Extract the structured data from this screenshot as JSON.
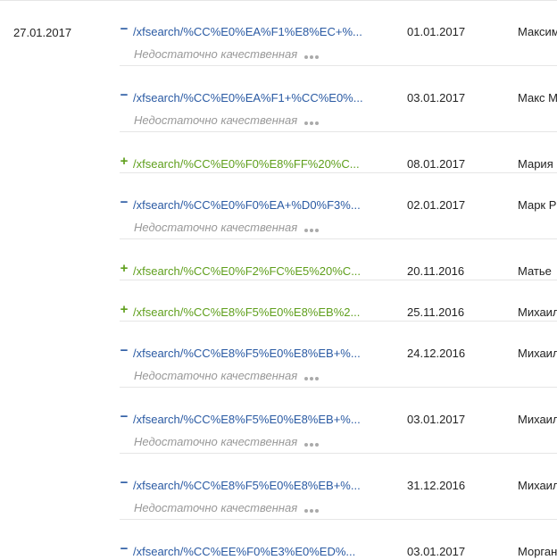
{
  "group": {
    "date": "27.01.2017"
  },
  "rows": [
    {
      "sign": "−",
      "url": "/xfsearch/%CC%E0%EA%F1%E8%EC+%...",
      "note": "Недостаточно качественная",
      "date": "01.01.2017",
      "name": "Максим"
    },
    {
      "sign": "−",
      "url": "/xfsearch/%CC%E0%EA%F1+%CC%E0%...",
      "note": "Недостаточно качественная",
      "date": "03.01.2017",
      "name": "Макс М"
    },
    {
      "sign": "+",
      "url": "/xfsearch/%CC%E0%F0%E8%FF%20%C...",
      "note": "",
      "date": "08.01.2017",
      "name": "Мария"
    },
    {
      "sign": "−",
      "url": "/xfsearch/%CC%E0%F0%EA+%D0%F3%...",
      "note": "Недостаточно качественная",
      "date": "02.01.2017",
      "name": "Марк Р"
    },
    {
      "sign": "+",
      "url": "/xfsearch/%CC%E0%F2%FC%E5%20%C...",
      "note": "",
      "date": "20.11.2016",
      "name": "Матье"
    },
    {
      "sign": "+",
      "url": "/xfsearch/%CC%E8%F5%E0%E8%EB%2...",
      "note": "",
      "date": "25.11.2016",
      "name": "Михаил"
    },
    {
      "sign": "−",
      "url": "/xfsearch/%CC%E8%F5%E0%E8%EB+%...",
      "note": "Недостаточно качественная",
      "date": "24.12.2016",
      "name": "Михаил"
    },
    {
      "sign": "−",
      "url": "/xfsearch/%CC%E8%F5%E0%E8%EB+%...",
      "note": "Недостаточно качественная",
      "date": "03.01.2017",
      "name": "Михаил"
    },
    {
      "sign": "−",
      "url": "/xfsearch/%CC%E8%F5%E0%E8%EB+%...",
      "note": "Недостаточно качественная",
      "date": "31.12.2016",
      "name": "Михаил"
    },
    {
      "sign": "−",
      "url": "/xfsearch/%CC%EE%F0%E3%E0%ED%...",
      "note": "",
      "date": "03.01.2017",
      "name": "Морган"
    }
  ],
  "colors": {
    "minus": "#2a5aa3",
    "plus": "#5f9f1c",
    "note": "#999999",
    "divider": "#e6e6e6"
  }
}
